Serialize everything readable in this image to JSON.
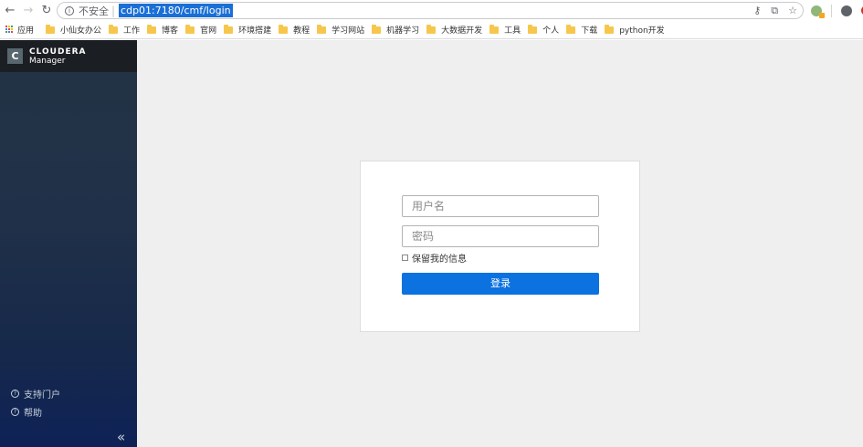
{
  "browser": {
    "security_label": "不安全",
    "separator": "|",
    "url": "cdp01:7180/cmf/login",
    "apps_label": "应用",
    "bookmarks": [
      "小仙女办公",
      "工作",
      "博客",
      "官网",
      "环境搭建",
      "教程",
      "学习网站",
      "机器学习",
      "大数据开发",
      "工具",
      "个人",
      "下载",
      "python开发"
    ]
  },
  "sidebar": {
    "brand": "CLOUDERA",
    "product": "Manager",
    "logo_letter": "C",
    "support_label": "支持门户",
    "help_label": "帮助",
    "collapse_glyph": "«"
  },
  "login": {
    "username_placeholder": "用户名",
    "password_placeholder": "密码",
    "remember_label": "保留我的信息",
    "submit_label": "登录"
  },
  "colors": {
    "accent": "#0b72e0",
    "sidebar_top": "#243445",
    "sidebar_bottom": "#0e2257",
    "logo_bar": "#1b1e22",
    "folder": "#f6c74c"
  }
}
